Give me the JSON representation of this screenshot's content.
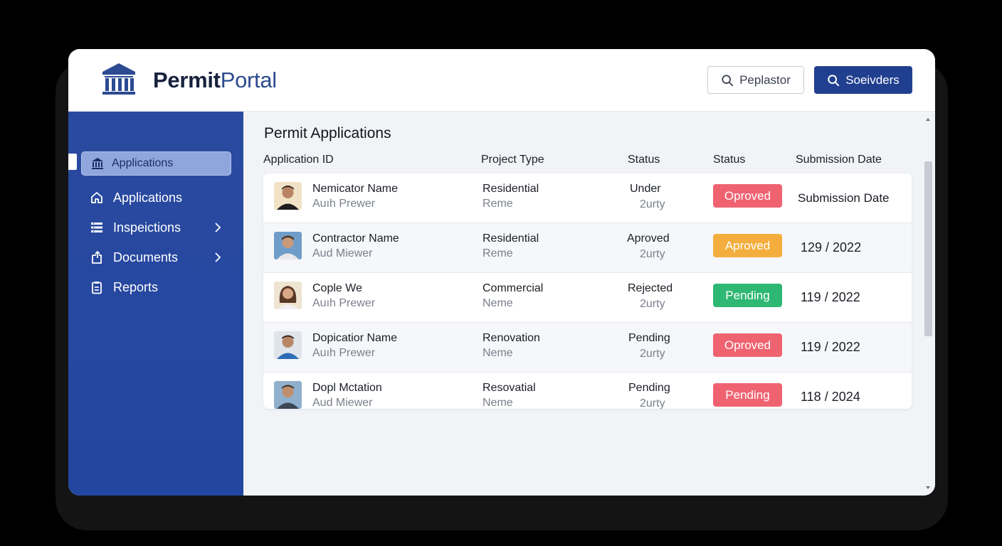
{
  "brand": {
    "part1": "Permit",
    "part2": "Portal",
    "logo_icon": "government-building-icon"
  },
  "header": {
    "search_button_label": "Peplastor",
    "primary_button_label": "Soeivders",
    "search_icon": "search-icon"
  },
  "sidebar": {
    "active": {
      "label": "Applications",
      "icon": "government-building-icon"
    },
    "items": [
      {
        "label": "Applications",
        "icon": "home-icon"
      },
      {
        "label": "Inspeictions",
        "icon": "list-icon",
        "has_chevron": true
      },
      {
        "label": "Documents",
        "icon": "document-upload-icon",
        "has_chevron": true
      },
      {
        "label": "Reports",
        "icon": "clipboard-icon"
      }
    ]
  },
  "main": {
    "title": "Permit Applications",
    "columns": [
      "Application ID",
      "Project Type",
      "Status",
      "Status",
      "Submission Date"
    ],
    "rows": [
      {
        "name": "Nemicator Name",
        "sub": "Auıh Prewer",
        "project": "Residential",
        "project_sub": "Reme",
        "status": "Under",
        "status_sub": "2urty",
        "badge": "Oproved",
        "badge_color": "#ef6371",
        "date": "Submission Date"
      },
      {
        "name": "Contractor Name",
        "sub": "Aud Miewer",
        "project": "Residential",
        "project_sub": "Reme",
        "status": "Aproved",
        "status_sub": "2urty",
        "badge": "Aproved",
        "badge_color": "#f4ae3d",
        "date": "129 / 2022"
      },
      {
        "name": "Cople We",
        "sub": "Auıh Prewer",
        "project": "Commercial",
        "project_sub": "Neme",
        "status": "Rejected",
        "status_sub": "2urty",
        "badge": "Pending",
        "badge_color": "#2fb873",
        "date": "119 / 2022"
      },
      {
        "name": "Dopicatior Name",
        "sub": "Auıh Prewer",
        "project": "Renovation",
        "project_sub": "Neme",
        "status": "Pending",
        "status_sub": "2urty",
        "badge": "Oproved",
        "badge_color": "#ef6371",
        "date": "119 / 2022"
      },
      {
        "name": "Dopl Mctation",
        "sub": "Aud Miewer",
        "project": "Resovatial",
        "project_sub": "Neme",
        "status": "Pending",
        "status_sub": "2urty",
        "badge": "Pending",
        "badge_color": "#ef6371",
        "date": "118 / 2024"
      }
    ]
  },
  "colors": {
    "sidebar": "#2a4a9f",
    "primary_button": "#203f8f",
    "brand_dark": "#16213d",
    "brand_accent": "#2d4b8e"
  }
}
